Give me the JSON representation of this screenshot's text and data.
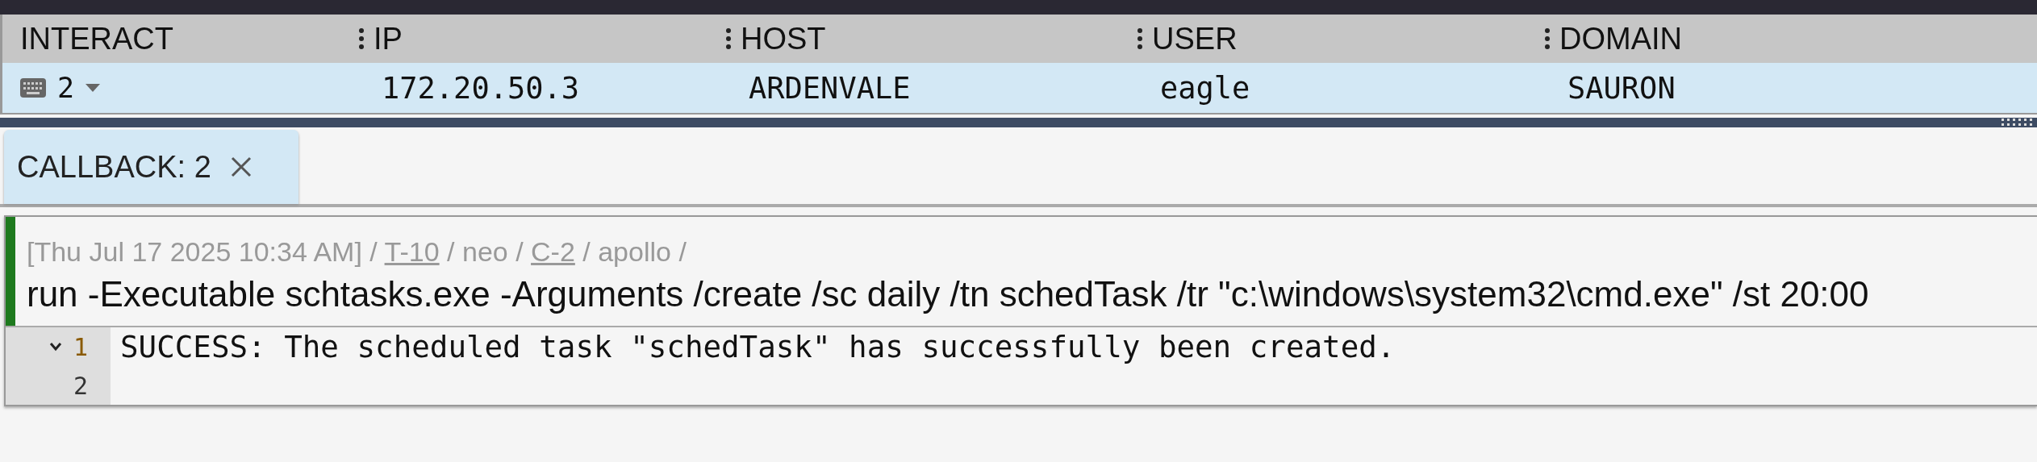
{
  "table": {
    "columns": [
      {
        "label": "INTERACT",
        "resizable": false
      },
      {
        "label": "IP",
        "resizable": true
      },
      {
        "label": "HOST",
        "resizable": true
      },
      {
        "label": "USER",
        "resizable": true
      },
      {
        "label": "DOMAIN",
        "resizable": true
      }
    ],
    "rows": [
      {
        "selected": true,
        "interact": "2",
        "ip": "172.20.50.3",
        "host": "ARDENVALE",
        "user": "eagle",
        "domain": "SAURON"
      }
    ]
  },
  "tabs": [
    {
      "label": "CALLBACK: 2",
      "selected": true
    }
  ],
  "task": {
    "meta": [
      {
        "kind": "text",
        "text": "[Thu Jul 17 2025 10:34 AM]"
      },
      {
        "kind": "link",
        "text": "T-10"
      },
      {
        "kind": "text",
        "text": "neo"
      },
      {
        "kind": "link",
        "text": "C-2"
      },
      {
        "kind": "text",
        "text": "apollo"
      }
    ],
    "separator": "/",
    "command": "run -Executable schtasks.exe -Arguments /create /sc daily /tn schedTask /tr \"c:\\windows\\system32\\cmd.exe\" /st 20:00",
    "output": [
      {
        "number": "1",
        "expanded": true,
        "text": "SUCCESS: The scheduled task \"schedTask\" has successfully been created."
      },
      {
        "number": "2"
      }
    ]
  }
}
